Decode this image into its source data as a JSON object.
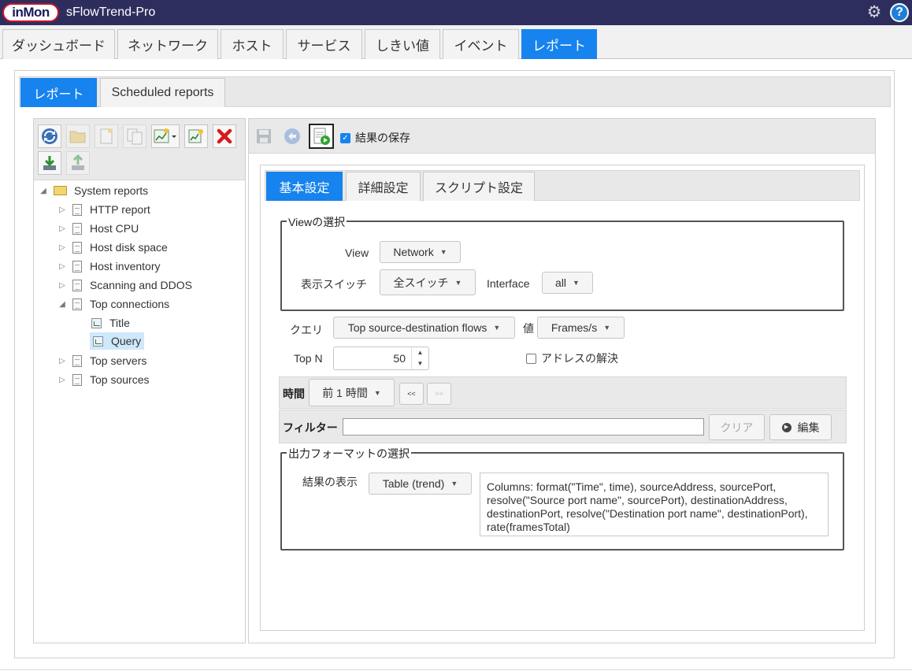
{
  "app": {
    "logo_text": "inMon",
    "title": "sFlowTrend-Pro"
  },
  "title_icons": [
    "gear-icon",
    "help-icon"
  ],
  "top_tabs": [
    "ダッシュボード",
    "ネットワーク",
    "ホスト",
    "サービス",
    "しきい値",
    "イベント",
    "レポート"
  ],
  "top_tabs_active": "レポート",
  "sub_tabs": [
    "レポート",
    "Scheduled reports"
  ],
  "sub_tabs_active": "レポート",
  "tree": {
    "root": "System reports",
    "items": [
      {
        "label": "HTTP report"
      },
      {
        "label": "Host CPU"
      },
      {
        "label": "Host disk space"
      },
      {
        "label": "Host inventory"
      },
      {
        "label": "Scanning and DDOS"
      },
      {
        "label": "Top connections",
        "expanded": true,
        "children": [
          "Title",
          "Query"
        ]
      },
      {
        "label": "Top servers"
      },
      {
        "label": "Top sources"
      }
    ],
    "selected": "Query"
  },
  "right_toolbar": {
    "save_results_label": "結果の保存",
    "save_results_checked": true
  },
  "inner_tabs": [
    "基本設定",
    "詳細設定",
    "スクリプト設定"
  ],
  "inner_tabs_active": "基本設定",
  "view_section": {
    "legend": "Viewの選択",
    "view_label": "View",
    "view_value": "Network",
    "switch_label": "表示スイッチ",
    "switch_value": "全スイッチ",
    "interface_label": "Interface",
    "interface_value": "all"
  },
  "query": {
    "label": "クエリ",
    "value": "Top source-destination flows",
    "value_label": "値",
    "value_value": "Frames/s",
    "topn_label": "Top N",
    "topn_value": "50",
    "resolve_label": "アドレスの解決",
    "resolve_checked": false
  },
  "time": {
    "label": "時間",
    "value": "前 1 時間",
    "prev_label": "<<",
    "next_label": ">>"
  },
  "filter": {
    "label": "フィルター",
    "value": "",
    "clear_label": "クリア",
    "edit_label": "編集"
  },
  "output_section": {
    "legend": "出力フォーマットの選択",
    "display_label": "結果の表示",
    "display_value": "Table (trend)",
    "columns_text": "Columns: format(\"Time\", time), sourceAddress, sourcePort, resolve(\"Source port name\", sourcePort), destinationAddress, destinationPort, resolve(\"Destination port name\", destinationPort), rate(framesTotal)"
  }
}
